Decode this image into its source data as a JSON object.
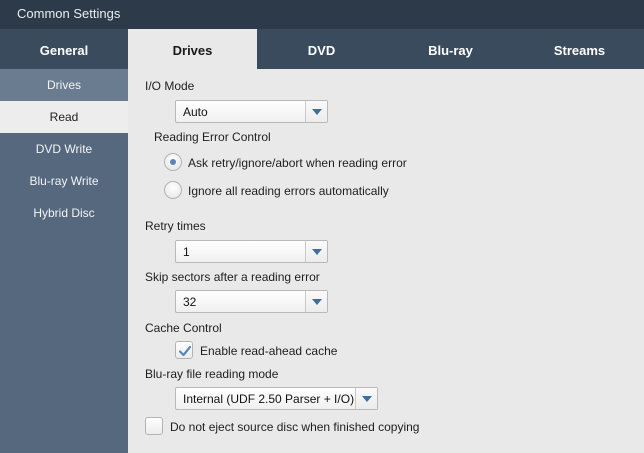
{
  "window": {
    "title": "Common Settings"
  },
  "tabs": [
    {
      "label": "General",
      "active": false
    },
    {
      "label": "Drives",
      "active": true
    },
    {
      "label": "DVD",
      "active": false
    },
    {
      "label": "Blu-ray",
      "active": false
    },
    {
      "label": "Streams",
      "active": false
    }
  ],
  "sidebar": {
    "items": [
      {
        "label": "Drives"
      },
      {
        "label": "Read",
        "active": true
      },
      {
        "label": "DVD Write"
      },
      {
        "label": "Blu-ray Write"
      },
      {
        "label": "Hybrid Disc"
      }
    ]
  },
  "read": {
    "io_mode": {
      "label": "I/O Mode",
      "value": "Auto"
    },
    "reading_error_control": {
      "label": "Reading Error Control",
      "options": [
        {
          "label": "Ask retry/ignore/abort when reading error",
          "selected": true
        },
        {
          "label": "Ignore all reading errors automatically",
          "selected": false
        }
      ]
    },
    "retry_times": {
      "label": "Retry times",
      "value": "1"
    },
    "skip_sectors": {
      "label": "Skip sectors after a reading error",
      "value": "32"
    },
    "cache_control": {
      "label": "Cache Control",
      "read_ahead": {
        "label": "Enable read-ahead cache",
        "checked": true
      }
    },
    "bluray_reading_mode": {
      "label": "Blu-ray file reading mode",
      "value": "Internal (UDF 2.50 Parser + I/O)"
    },
    "no_eject": {
      "label": "Do not eject source disc when finished copying",
      "checked": false
    }
  },
  "colors": {
    "titlebar": "#2d3a49",
    "tabbar": "#3b4b5e",
    "sidebar": "#56687d",
    "content": "#e9e9e9",
    "accent": "#5a86b8"
  }
}
